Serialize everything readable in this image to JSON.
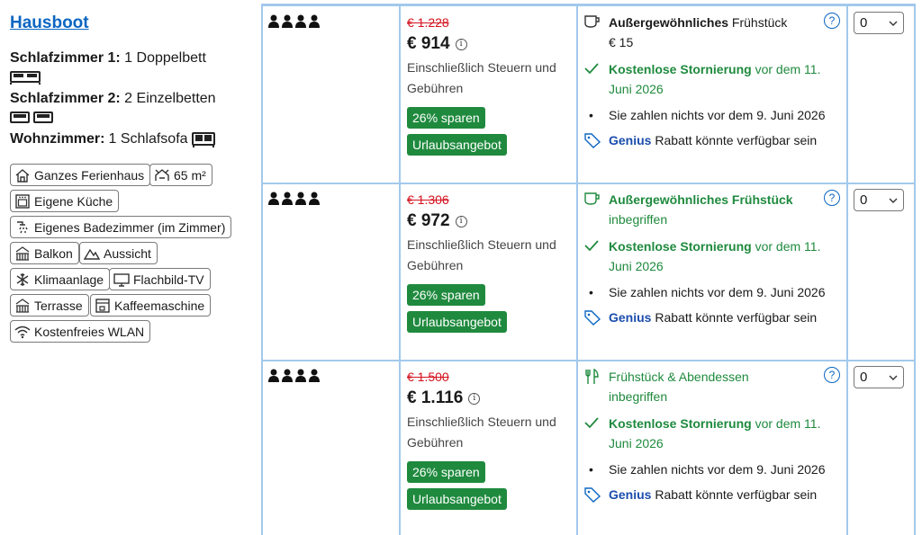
{
  "room": {
    "title": "Hausboot",
    "beds": [
      {
        "label": "Schlafzimmer 1:",
        "value": "1 Doppelbett",
        "icon": "double-bed-icon"
      },
      {
        "label": "Schlafzimmer 2:",
        "value": "2 Einzelbetten",
        "icon": "single-beds-icon"
      },
      {
        "label": "Wohnzimmer:",
        "value": "1 Schlafsofa",
        "icon": "sofa-bed-icon"
      }
    ],
    "facilities": [
      {
        "label": "Ganzes Ferienhaus",
        "icon": "house-icon"
      },
      {
        "label": "65 m²",
        "icon": "room-size-icon"
      },
      {
        "label": "Eigene Küche",
        "icon": "kitchen-icon"
      },
      {
        "label": "Eigenes Badezimmer (im Zimmer)",
        "icon": "bathroom-icon"
      },
      {
        "label": "Balkon",
        "icon": "balcony-icon"
      },
      {
        "label": "Aussicht",
        "icon": "mountain-view-icon"
      },
      {
        "label": "Klimaanlage",
        "icon": "snowflake-icon"
      },
      {
        "label": "Flachbild-TV",
        "icon": "tv-icon"
      },
      {
        "label": "Terrasse",
        "icon": "terrace-icon"
      },
      {
        "label": "Kaffeemaschine",
        "icon": "coffee-machine-icon"
      },
      {
        "label": "Kostenfreies WLAN",
        "icon": "wifi-icon"
      }
    ]
  },
  "rates": [
    {
      "persons": 4,
      "old_price": "€ 1.228",
      "price": "€ 914",
      "taxes": "Einschließlich Steuern und Gebühren",
      "save_badge": "26% sparen",
      "deal_badge": "Urlaubsangebot",
      "meal_bold": "Außergewöhnliches",
      "meal_rest": " Frühstück",
      "meal_line2": "€ 15",
      "cancel_bold": "Kostenlose Stornierung",
      "cancel_rest": " vor dem 11. Juni 2026",
      "pay": "Sie zahlen nichts vor dem 9. Juni 2026",
      "genius": "Genius",
      "genius_rest": " Rabatt könnte verfügbar sein",
      "select_value": "0"
    },
    {
      "persons": 4,
      "old_price": "€ 1.306",
      "price": "€ 972",
      "taxes": "Einschließlich Steuern und Gebühren",
      "save_badge": "26% sparen",
      "deal_badge": "Urlaubsangebot",
      "meal_bold": "Außergewöhnliches Frühstück",
      "meal_rest": "",
      "meal_line2": "inbegriffen",
      "cancel_bold": "Kostenlose Stornierung",
      "cancel_rest": " vor dem 11. Juni 2026",
      "pay": "Sie zahlen nichts vor dem 9. Juni 2026",
      "genius": "Genius",
      "genius_rest": " Rabatt könnte verfügbar sein",
      "select_value": "0"
    },
    {
      "persons": 4,
      "old_price": "€ 1.500",
      "price": "€ 1.116",
      "taxes": "Einschließlich Steuern und Gebühren",
      "save_badge": "26% sparen",
      "deal_badge": "Urlaubsangebot",
      "meal_bold": "",
      "meal_rest": "Frühstück & Abendessen",
      "meal_line2": "inbegriffen",
      "cancel_bold": "Kostenlose Stornierung",
      "cancel_rest": " vor dem 11. Juni 2026",
      "pay": "Sie zahlen nichts vor dem 9. Juni 2026",
      "genius": "Genius",
      "genius_rest": " Rabatt könnte verfügbar sein",
      "select_value": "0"
    }
  ],
  "colors": {
    "link": "#0b66c2",
    "green": "#1f8a3e",
    "strike": "#d4111e",
    "border": "#a3c9ec",
    "genius": "#1b4dad"
  }
}
